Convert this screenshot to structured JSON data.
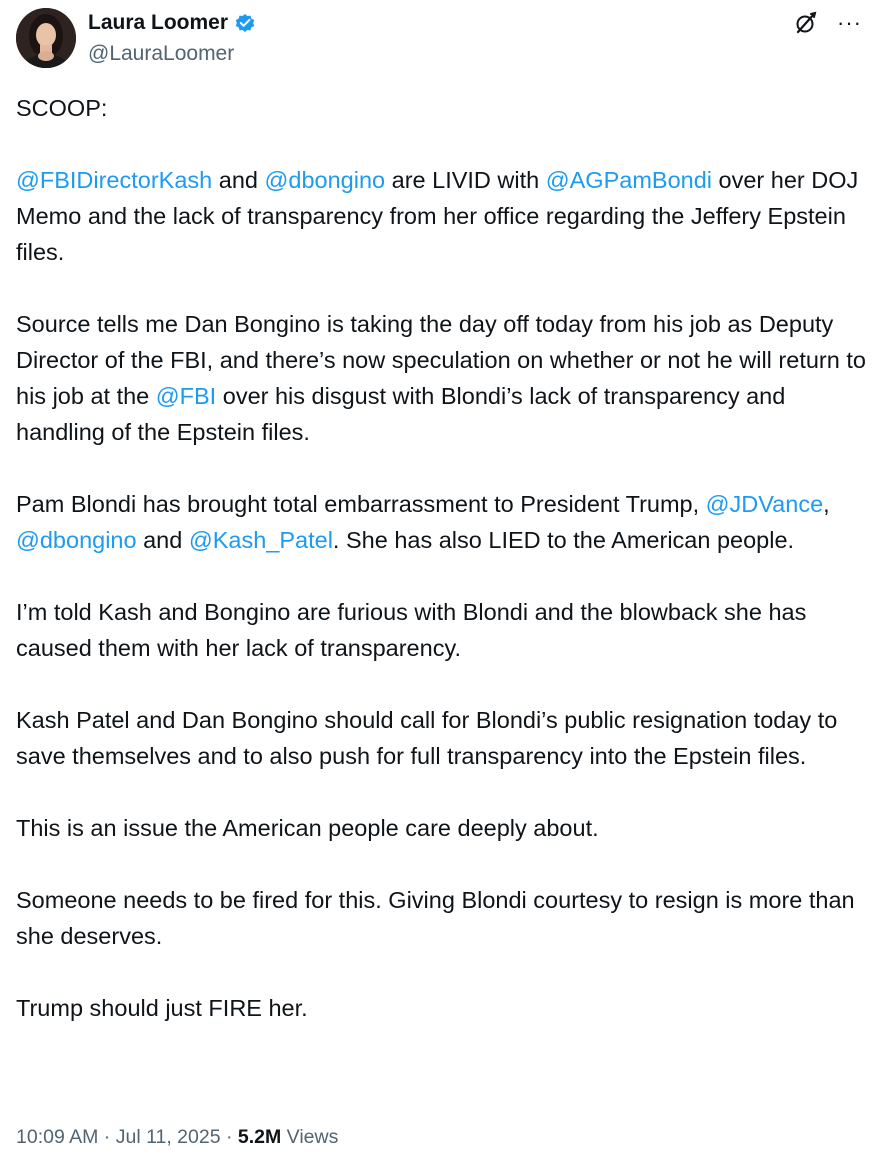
{
  "author": {
    "name": "Laura Loomer",
    "handle": "@LauraLoomer",
    "verified": true,
    "verified_color": "#1d9bf0"
  },
  "icons": {
    "grok": "grok-icon",
    "more": "more-options-icon"
  },
  "tweet": {
    "mention_color": "#1d9bf0",
    "paragraphs": [
      [
        {
          "t": "SCOOP:"
        }
      ],
      [
        {
          "t": "@FBIDirectorKash",
          "m": true
        },
        {
          "t": " and "
        },
        {
          "t": "@dbongino",
          "m": true
        },
        {
          "t": " are LIVID with "
        },
        {
          "t": "@AGPamBondi",
          "m": true
        },
        {
          "t": " over her DOJ Memo and the lack of transparency from her office regarding the Jeffery Epstein files."
        }
      ],
      [
        {
          "t": "Source tells me Dan Bongino is taking the day off today from his job as Deputy Director of the FBI, and there’s now speculation on whether or not he will return to his job at the "
        },
        {
          "t": "@FBI",
          "m": true
        },
        {
          "t": " over his disgust with Blondi’s lack of transparency and handling of the Epstein files."
        }
      ],
      [
        {
          "t": "Pam Blondi has brought total embarrassment to President Trump, "
        },
        {
          "t": "@JDVance",
          "m": true
        },
        {
          "t": ", "
        },
        {
          "t": "@dbongino",
          "m": true
        },
        {
          "t": " and "
        },
        {
          "t": "@Kash_Patel",
          "m": true
        },
        {
          "t": ". She has also LIED to the American people."
        }
      ],
      [
        {
          "t": "I’m told Kash and Bongino are furious with Blondi and the blowback she has caused them with her lack of transparency."
        }
      ],
      [
        {
          "t": "Kash Patel and Dan Bongino should call for Blondi’s public resignation today to save themselves and to also push for full transparency into the Epstein files."
        }
      ],
      [
        {
          "t": "This is an issue the American people care deeply about."
        }
      ],
      [
        {
          "t": "Someone needs to be fired for this. Giving Blondi courtesy to resign is more than she deserves."
        }
      ],
      [
        {
          "t": "Trump should just FIRE her."
        }
      ]
    ]
  },
  "meta": {
    "time": "10:09 AM",
    "separator": " · ",
    "date": "Jul 11, 2025",
    "views_count": "5.2M",
    "views_label": " Views"
  }
}
